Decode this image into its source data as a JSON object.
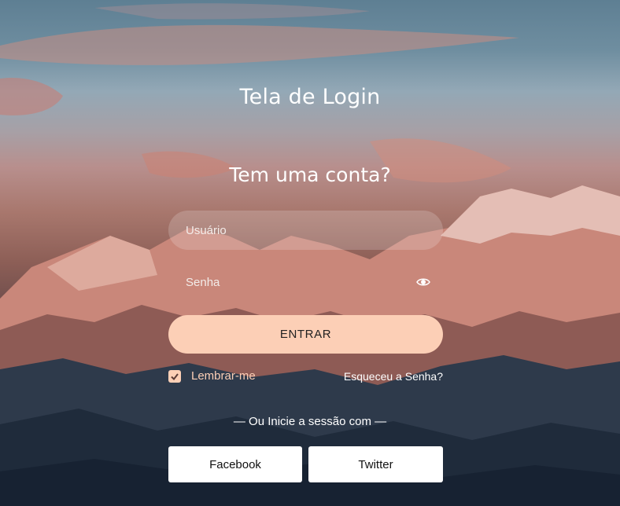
{
  "page": {
    "title": "Tela de Login",
    "subtitle": "Tem uma conta?"
  },
  "form": {
    "username_placeholder": "Usuário",
    "password_placeholder": "Senha",
    "submit_label": "ENTRAR",
    "remember_label": "Lembrar-me",
    "remember_checked": true,
    "forgot_label": "Esqueceu a Senha?"
  },
  "social": {
    "divider_text": "— Ou Inicie a sessão com —",
    "facebook_label": "Facebook",
    "twitter_label": "Twitter"
  },
  "icons": {
    "password_toggle": "eye-icon",
    "remember_check": "check-icon"
  },
  "colors": {
    "accent": "#fccfb6",
    "text": "#ffffff"
  }
}
